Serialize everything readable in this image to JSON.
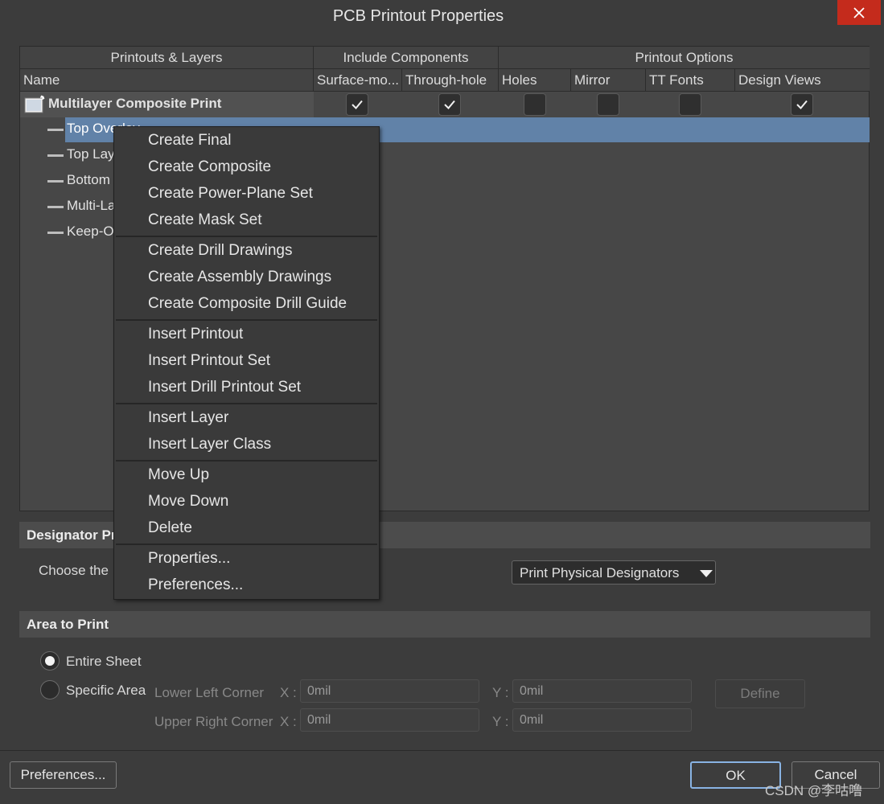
{
  "window": {
    "title": "PCB Printout Properties"
  },
  "table": {
    "groups": [
      "Printouts & Layers",
      "Include Components",
      "Printout Options"
    ],
    "columns": [
      "Name",
      "Surface-mo...",
      "Through-hole",
      "Holes",
      "Mirror",
      "TT Fonts",
      "Design Views"
    ],
    "printout": {
      "name": "Multilayer Composite Print",
      "checks": {
        "surface_mount": true,
        "through_hole": true,
        "holes": false,
        "mirror": false,
        "tt_fonts": false,
        "design_views": true
      }
    },
    "layers": [
      "Top Overlay",
      "Top Lay",
      "Bottom",
      "Multi-La",
      "Keep-O"
    ],
    "selected_layer": "Top Overlay"
  },
  "context_menu": {
    "groups": [
      [
        "Create Final",
        "Create Composite",
        "Create Power-Plane Set",
        "Create Mask Set"
      ],
      [
        "Create Drill Drawings",
        "Create Assembly Drawings",
        "Create Composite Drill Guide"
      ],
      [
        "Insert Printout",
        "Insert Printout Set",
        "Insert Drill Printout Set"
      ],
      [
        "Insert Layer",
        "Insert Layer Class"
      ],
      [
        "Move Up",
        "Move Down",
        "Delete"
      ],
      [
        "Properties...",
        "Preferences..."
      ]
    ]
  },
  "designator": {
    "header": "Designator Pr",
    "label": "Choose the",
    "dropdown_value": "Print Physical Designators"
  },
  "area": {
    "header": "Area to Print",
    "entire_sheet": "Entire Sheet",
    "specific_area": "Specific Area",
    "selected": "Entire Sheet",
    "lower_left": "Lower Left Corner",
    "upper_right": "Upper Right Corner",
    "x_label": "X :",
    "y_label": "Y :",
    "ll_x": "0mil",
    "ll_y": "0mil",
    "ur_x": "0mil",
    "ur_y": "0mil",
    "define": "Define"
  },
  "footer": {
    "preferences": "Preferences...",
    "ok": "OK",
    "cancel": "Cancel"
  },
  "watermark": "CSDN @李咕噜",
  "colors": {
    "selection": "#6182a8",
    "close": "#c42b1c",
    "ok_border": "#89b3e3"
  }
}
